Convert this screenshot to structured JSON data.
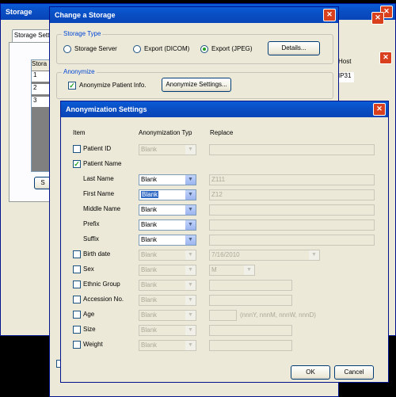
{
  "storage_window": {
    "title": "Storage",
    "tab": "Storage Setti",
    "table_headers": [
      "Stora",
      "Host"
    ],
    "rows": [
      "1",
      "2",
      "3"
    ],
    "host_cells": [
      "IP31",
      ""
    ],
    "side_button": "S"
  },
  "change_storage": {
    "title": "Change a Storage",
    "storage_type_label": "Storage Type",
    "options": [
      "Storage Server",
      "Export (DICOM)",
      "Export (JPEG)"
    ],
    "selected_option": "Export (JPEG)",
    "details_button": "Details...",
    "anonymize_label": "Anonymize",
    "anonymize_checkbox": "Anonymize Patient Info.",
    "anonymize_settings_button": "Anonymize Settings..."
  },
  "anon_dialog": {
    "title": "Anonymization Settings",
    "headers": {
      "item": "Item",
      "type": "Anonymization Typ",
      "replace": "Replace"
    },
    "ok_label": "OK",
    "cancel_label": "Cancel",
    "date_hint": "(nnnY, nnnM, nnnW, nnnD)",
    "rows": [
      {
        "label": "Patient ID",
        "checkbox": true,
        "checked": false,
        "type": "Blank",
        "type_enabled": false,
        "replace": "",
        "replace_kind": "text"
      },
      {
        "label": "Patient Name",
        "checkbox": true,
        "checked": true
      },
      {
        "label": "Last Name",
        "checkbox": false,
        "type": "Blank",
        "type_enabled": true,
        "replace": "Z111",
        "replace_kind": "text"
      },
      {
        "label": "First Name",
        "checkbox": false,
        "type": "Blank",
        "type_enabled": true,
        "highlighted": true,
        "replace": "Z12",
        "replace_kind": "text"
      },
      {
        "label": "Middle Name",
        "checkbox": false,
        "type": "Blank",
        "type_enabled": true,
        "replace": "",
        "replace_kind": "text"
      },
      {
        "label": "Prefix",
        "checkbox": false,
        "type": "Blank",
        "type_enabled": true,
        "replace": "",
        "replace_kind": "text"
      },
      {
        "label": "Suffix",
        "checkbox": false,
        "type": "Blank",
        "type_enabled": true,
        "replace": "",
        "replace_kind": "text"
      },
      {
        "label": "Birth date",
        "checkbox": true,
        "checked": false,
        "type": "Blank",
        "type_enabled": false,
        "replace": "7/16/2010",
        "replace_kind": "combo"
      },
      {
        "label": "Sex",
        "checkbox": true,
        "checked": false,
        "type": "Blank",
        "type_enabled": false,
        "replace": "M",
        "replace_kind": "combo-small"
      },
      {
        "label": "Ethnic Group",
        "checkbox": true,
        "checked": false,
        "type": "Blank",
        "type_enabled": false,
        "replace": "",
        "replace_kind": "text-medium"
      },
      {
        "label": "Accession No.",
        "checkbox": true,
        "checked": false,
        "type": "Blank",
        "type_enabled": false,
        "replace": "",
        "replace_kind": "text-medium"
      },
      {
        "label": "Age",
        "checkbox": true,
        "checked": false,
        "type": "Blank",
        "type_enabled": false,
        "replace": "",
        "replace_kind": "text-small"
      },
      {
        "label": "Size",
        "checkbox": true,
        "checked": false,
        "type": "Blank",
        "type_enabled": false,
        "replace": "",
        "replace_kind": "text-medium"
      },
      {
        "label": "Weight",
        "checkbox": true,
        "checked": false,
        "type": "Blank",
        "type_enabled": false,
        "replace": "",
        "replace_kind": "text-medium"
      }
    ]
  }
}
